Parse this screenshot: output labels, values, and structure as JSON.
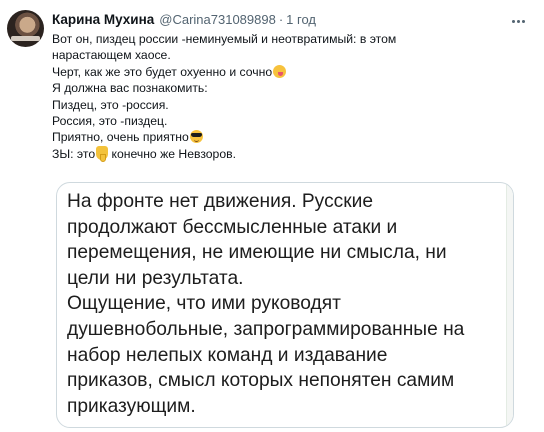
{
  "tweet": {
    "author_name": "Карина Мухина",
    "handle": "@Carina731089898",
    "separator": "·",
    "time": "1 год",
    "more_icon": "more-horizontal-icon",
    "lines": [
      {
        "text": "Вот он, пиздец россии -неминуемый и неотвратимый: в этом"
      },
      {
        "text": "нарастающем хаосе."
      },
      {
        "text": "Черт, как же это будет охуенно и сочно",
        "emoji": "face-savoring-food-icon"
      },
      {
        "text": "Я должна вас познакомить:"
      },
      {
        "text": "Пиздец, это -россия."
      },
      {
        "text": "Россия, это -пиздец."
      },
      {
        "text": "Приятно, очень приятно",
        "emoji": "smiling-face-with-sunglasses-icon"
      },
      {
        "text": "ЗЫ: это",
        "emoji": "backhand-index-pointing-down-icon",
        "after": " конечно же Невзоров."
      }
    ]
  },
  "media": {
    "lines": [
      "На фронте нет движения. Русские",
      "продолжают бессмысленные атаки и",
      "перемещения, не имеющие ни смысла, ни",
      "цели ни результата.",
      "Ощущение, что ими руководят",
      "душевнобольные, запрограммированные на",
      "набор нелепых команд и издавание",
      "приказов, смысл которых непонятен самим",
      "приказующим."
    ]
  },
  "colors": {
    "text": "#0f1419",
    "secondary": "#536471",
    "border": "#cfd9de"
  }
}
